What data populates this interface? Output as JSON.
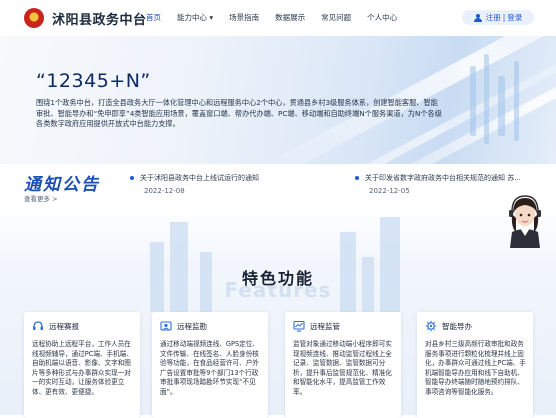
{
  "header": {
    "site_title": "沭阳县政务中台",
    "nav": [
      {
        "label": "首页"
      },
      {
        "label": "能力中心 ▾"
      },
      {
        "label": "场景指南"
      },
      {
        "label": "数据展示"
      },
      {
        "label": "常见问题"
      },
      {
        "label": "个人中心"
      }
    ],
    "auth": {
      "register": "注册",
      "separator": "|",
      "login": "登录"
    }
  },
  "hero": {
    "heading": "“12345+N”",
    "description": "围绕1个政务中台，打造全县政务大厅一体化管理中心和远程服务中心2个中心，贯通县乡村3级服务体系，创建智能客服、智能审批、智能导办和“免申即享”4类智能应用场景，覆盖窗口端、帮办代办端、PC端、移动端和自助终端N个服务渠道，为N个各级各类数字政府应用提供开放式中台能力支撑。"
  },
  "notices": {
    "title": "通知公告",
    "more": "查看更多 >",
    "items": [
      {
        "text": "关于沭阳县政务中台上线试运行的通知",
        "date": "2022-12-08"
      },
      {
        "text": "关于印发省数字政府政务中台相关规范的通知 苏...",
        "date": "2022-12-05"
      }
    ]
  },
  "features": {
    "title": "特色功能",
    "bg_text": "Features",
    "cards": [
      {
        "icon": "remote-help-icon",
        "name": "远程赛报",
        "desc": "远程协助上远程平台，工作人员在线视频辅导，通过PC端、手机端、自助机端以语音、影像、文字和图片等多种形式与办事群众实现一对一的实时互动，让服务体验更立体、更有效、更便捷。"
      },
      {
        "icon": "remote-monitor-icon",
        "name": "远程监勘",
        "desc": "通过移动端视频连线、GPS定位、文件传输、在线签名、人脸身份核验等功能，在食品经营许可、户外广告设置审批等9个部门13个行政审批事项现场踏勘环节实现“不见面”。"
      },
      {
        "icon": "remote-supervise-icon",
        "name": "远程监管",
        "desc": "监管对象通过移动端小程序即可实现视频连线、推动监管过程线上全记录、监管数据、监管数据可分析，提升事后监管规范化、精准化和智能化水平，提高监管工作效率。"
      },
      {
        "icon": "smart-guide-icon",
        "name": "智能导办",
        "desc": "对县乡村三级高频行政审批和政务服务事项进行颗粒化梳理并线上固化，办事群众可通过线上PC端、手机端智能导办应用和线下自助机、智能导办终端随时随地预约排队、事项咨询等智能化服务。"
      }
    ]
  },
  "colors": {
    "accent": "#1d5bd6",
    "notice_title": "#1c4fb5",
    "hero_heading": "#0e2a64"
  }
}
